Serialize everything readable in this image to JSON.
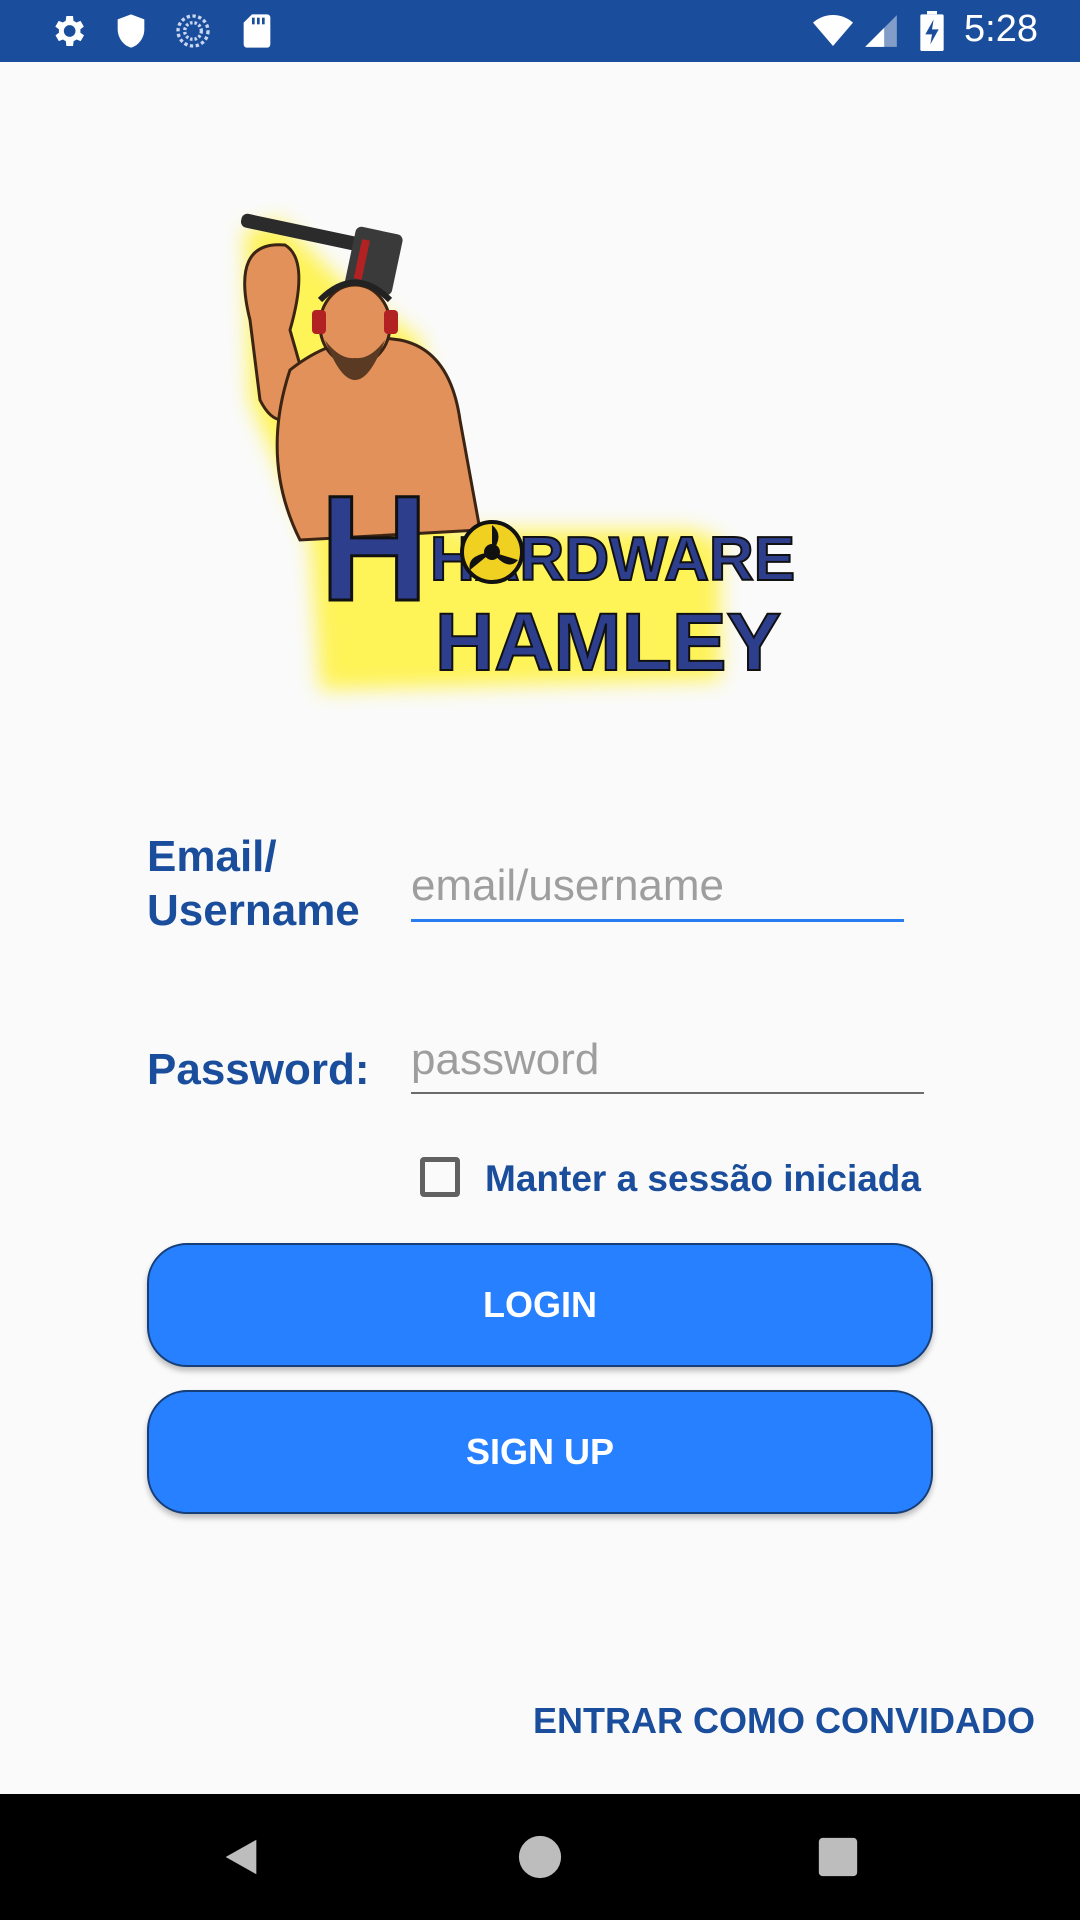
{
  "status_bar": {
    "time": "5:28",
    "icons": [
      "gear-icon",
      "shield-icon",
      "sync-icon",
      "sd-card-icon",
      "wifi-icon",
      "signal-icon",
      "battery-charging-icon"
    ]
  },
  "logo": {
    "text_line1": "HARDWARE",
    "text_line2": "HAMLEY",
    "glow_color": "#fff23a",
    "text_color": "#2c3e8c"
  },
  "form": {
    "email_label_line1": "Email/",
    "email_label_line2": "Username",
    "email_placeholder": "email/username",
    "password_label": "Password:",
    "password_placeholder": "password",
    "keep_session_label": "Manter a sessão iniciada",
    "keep_session_checked": false
  },
  "buttons": {
    "login_label": "LOGIN",
    "signup_label": "SIGN UP",
    "guest_label": "ENTRAR COMO CONVIDADO"
  },
  "colors": {
    "status_bar": "#1a4e9c",
    "primary_text": "#1a4e9c",
    "button": "#2680ff",
    "focus_underline": "#2a7df0"
  },
  "nav_bar": {
    "icons": [
      "back-icon",
      "home-icon",
      "recents-icon"
    ]
  }
}
